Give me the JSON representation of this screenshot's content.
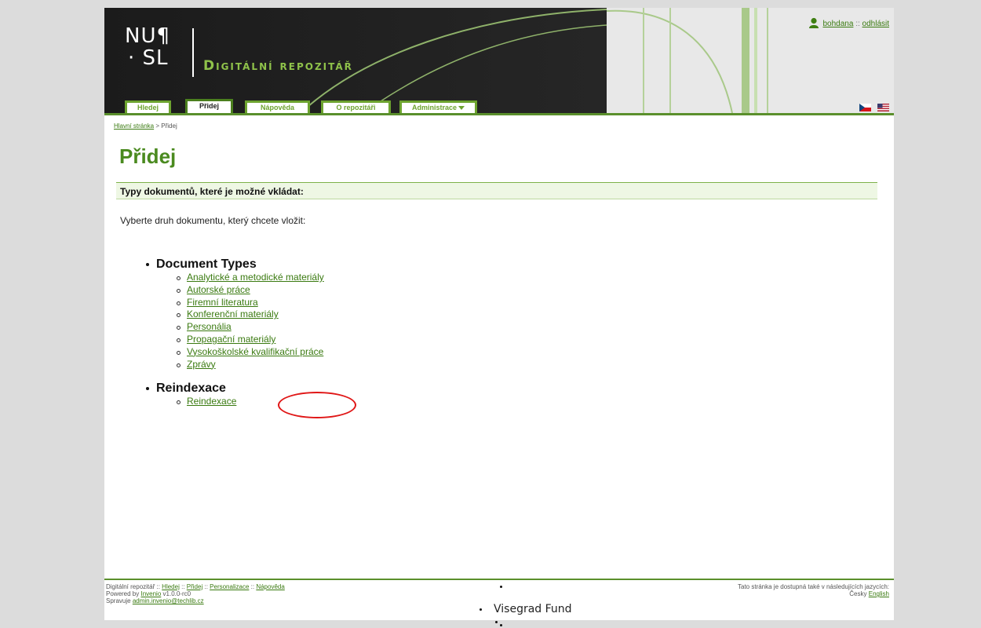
{
  "header": {
    "logo_line1": "NU¶",
    "logo_line2": "· SL",
    "site_title": "Digitální repozitář",
    "tabs": [
      {
        "label": "Hledej"
      },
      {
        "label": "Přidej"
      },
      {
        "label": "Nápověda"
      },
      {
        "label": "O repozitáři"
      },
      {
        "label": "Administrace"
      }
    ],
    "user": {
      "name": "bohdana",
      "separator": "::",
      "logout": "odhlásit"
    },
    "flags": {
      "cz": "czech-flag-icon",
      "us": "us-flag-icon"
    }
  },
  "breadcrumb": {
    "home": "Hlavní stránka",
    "sep": ">",
    "current": "Přidej"
  },
  "page_title": "Přidej",
  "section_heading": "Typy dokumentů, které je možné vkládat:",
  "intro": "Vyberte druh dokumentu, který chcete vložit:",
  "groups": [
    {
      "title": "Document Types",
      "items": [
        "Analytické a metodické materiály",
        "Autorské práce",
        "Firemní literatura",
        "Konferenční materiály",
        "Personália",
        "Propagační materiály",
        "Vysokoškolské kvalifikační práce",
        "Zprávy"
      ]
    },
    {
      "title": "Reindexace",
      "items": [
        "Reindexace"
      ]
    }
  ],
  "colors": {
    "accent": "#4a8a1f",
    "link": "#3a7a10",
    "highlight": "#e01717"
  },
  "footer": {
    "line1_prefix": "Digitální repozitář",
    "sep": "::",
    "links": [
      "Hledej",
      "Přidej",
      "Personalizace",
      "Nápověda"
    ],
    "powered_prefix": "Powered by",
    "powered_link": "Invenio",
    "version": "v1.0.0-rc0",
    "maintained_prefix": "Spravuje",
    "admin_email": "admin.invenio@techlib.cz",
    "lang_note": "Tato stránka je dostupná také v následujících jazycích:",
    "lang_cz": "Česky",
    "lang_en": "English",
    "sponsor": "Visegrad Fund"
  }
}
